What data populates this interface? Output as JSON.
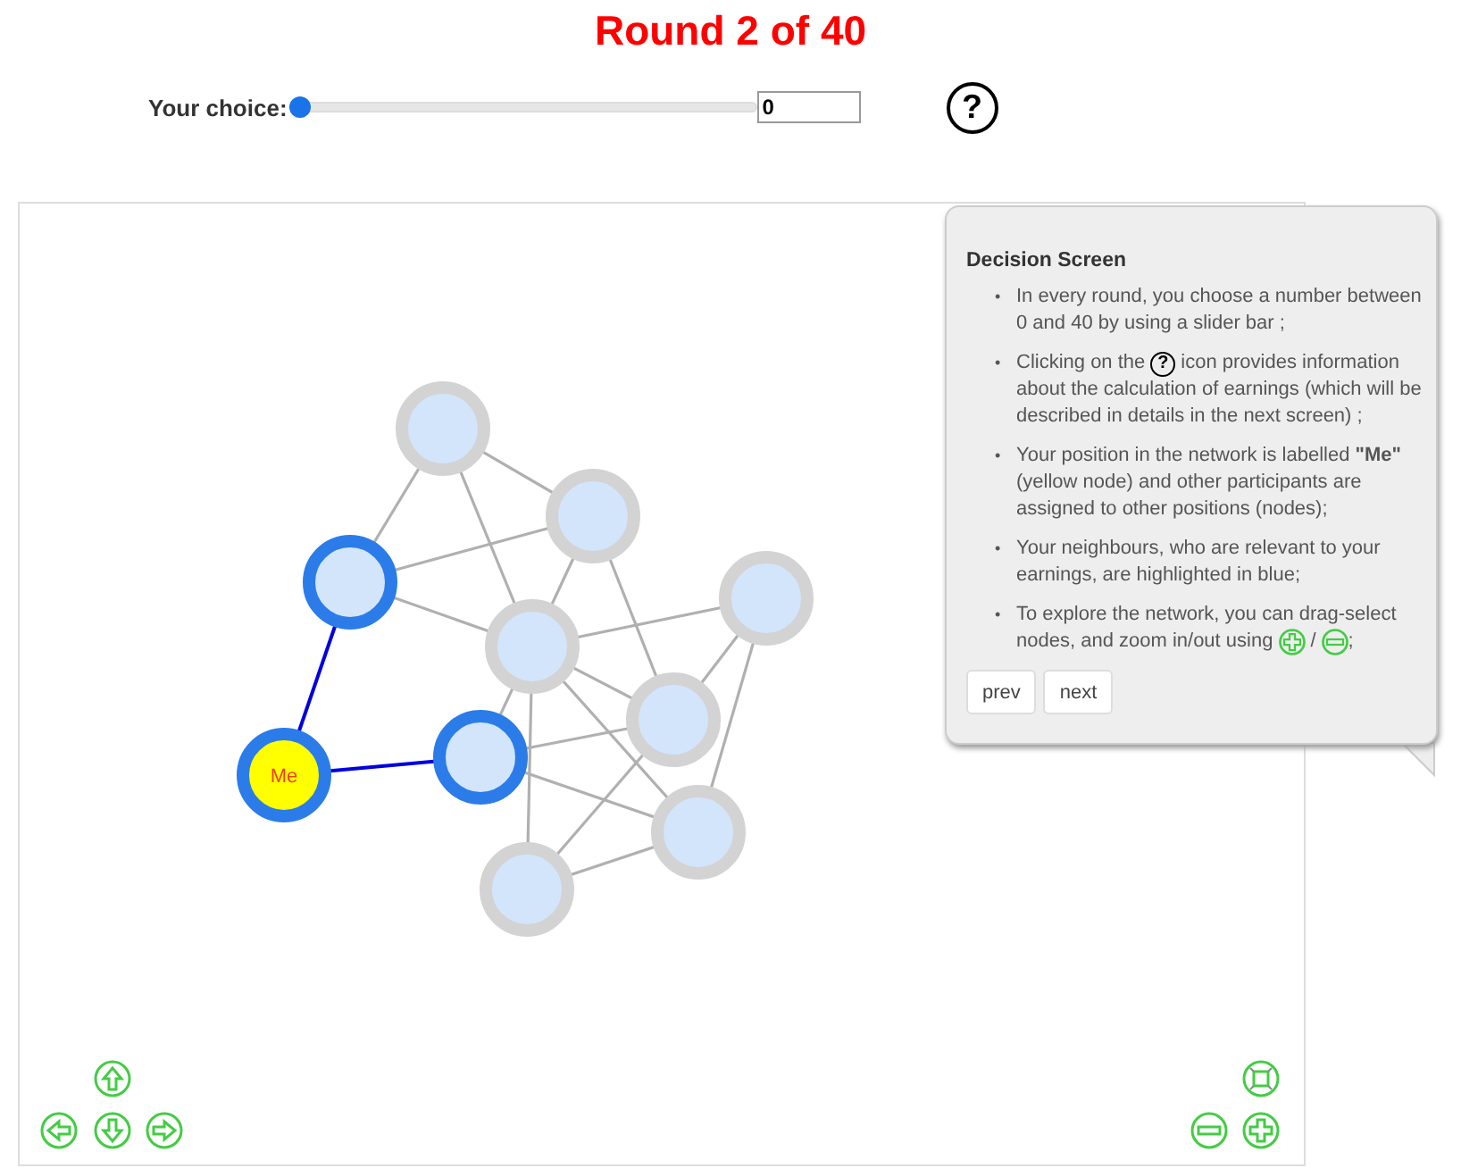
{
  "title": "Round 2 of 40",
  "choice": {
    "label": "Your choice:",
    "level": 0,
    "value": "0",
    "help": "?"
  },
  "network": {
    "nodes": [
      {
        "kind": "other"
      },
      {
        "kind": "other"
      },
      {
        "kind": "neighbor"
      },
      {
        "kind": "other"
      },
      {
        "kind": "other"
      },
      {
        "kind": "other"
      },
      {
        "kind": "neighbor"
      },
      {
        "kind": "me",
        "label": "Me"
      },
      {
        "kind": "other"
      },
      {
        "kind": "other"
      }
    ],
    "edges": [
      {
        "highlighted": false
      },
      {
        "highlighted": false
      },
      {
        "highlighted": false
      },
      {
        "highlighted": false
      },
      {
        "highlighted": false
      },
      {
        "highlighted": true
      },
      {
        "highlighted": true
      },
      {
        "highlighted": false
      },
      {
        "highlighted": false
      },
      {
        "highlighted": false
      },
      {
        "highlighted": false
      },
      {
        "highlighted": false
      },
      {
        "highlighted": false
      },
      {
        "highlighted": false
      },
      {
        "highlighted": false
      },
      {
        "highlighted": false
      },
      {
        "highlighted": false
      },
      {
        "highlighted": false
      },
      {
        "highlighted": false
      },
      {
        "highlighted": false
      }
    ]
  },
  "tooltip": {
    "heading": "Decision Screen",
    "items": [
      {
        "kind": "text",
        "marker": "•",
        "text": "In every round, you choose a number between 0 and 40 by using a slider bar ;"
      },
      {
        "kind": "help",
        "marker": "•",
        "before": "Clicking on the",
        "icon": "?",
        "after": "icon provides information",
        "rest": "about the calculation of earnings (which will be described in details in the next screen) ;"
      },
      {
        "kind": "text",
        "marker": "•",
        "text": "Your position in the network is labelled **\"Me\"** (yellow node) and other participants are assigned to other positions (nodes);"
      },
      {
        "kind": "text",
        "marker": "•",
        "text": "Your neighbours, who are relevant to your earnings, are highlighted in blue;"
      },
      {
        "kind": "zoom",
        "marker": "•",
        "before": "To explore the network, you can drag-select",
        "line": "nodes, and zoom in/out using",
        "separator": "/",
        "after": ";"
      }
    ],
    "buttons": [
      "prev",
      "next"
    ]
  }
}
